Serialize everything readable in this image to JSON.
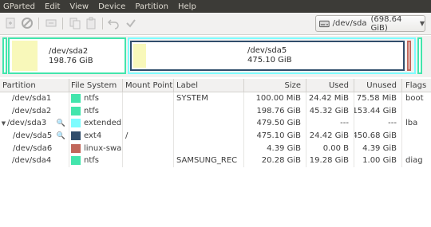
{
  "menu": [
    "GParted",
    "Edit",
    "View",
    "Device",
    "Partition",
    "Help"
  ],
  "toolbar": {
    "icons": [
      "new-icon",
      "delete-icon",
      "resize-icon",
      "copy-icon",
      "paste-icon",
      "undo-icon",
      "apply-icon"
    ]
  },
  "device": {
    "name": "/dev/sda",
    "size": "(698.64 GiB)"
  },
  "diskmap": {
    "sda2": {
      "name": "/dev/sda2",
      "size": "198.76 GiB"
    },
    "sda5": {
      "name": "/dev/sda5",
      "size": "475.10 GiB"
    }
  },
  "columns": [
    "Partition",
    "File System",
    "Mount Point",
    "Label",
    "Size",
    "Used",
    "Unused",
    "Flags"
  ],
  "rows": [
    {
      "partition": "/dev/sda1",
      "fs": "ntfs",
      "fs_color": "#42e5ac",
      "mount": "",
      "label": "SYSTEM",
      "size": "100.00 MiB",
      "used": "24.42 MiB",
      "unused": "75.58 MiB",
      "flags": "boot",
      "level": 0
    },
    {
      "partition": "/dev/sda2",
      "fs": "ntfs",
      "fs_color": "#42e5ac",
      "mount": "",
      "label": "",
      "size": "198.76 GiB",
      "used": "45.32 GiB",
      "unused": "153.44 GiB",
      "flags": "",
      "level": 0
    },
    {
      "partition": "/dev/sda3",
      "fs": "extended",
      "fs_color": "#7dfcfe",
      "mount": "",
      "label": "",
      "size": "479.50 GiB",
      "used": "---",
      "unused": "---",
      "flags": "lba",
      "level": 0
    },
    {
      "partition": "/dev/sda5",
      "fs": "ext4",
      "fs_color": "#314e6c",
      "mount": "/",
      "label": "",
      "size": "475.10 GiB",
      "used": "24.42 GiB",
      "unused": "450.68 GiB",
      "flags": "",
      "level": 1
    },
    {
      "partition": "/dev/sda6",
      "fs": "linux-swap",
      "fs_color": "#c1665a",
      "mount": "",
      "label": "",
      "size": "4.39 GiB",
      "used": "0.00 B",
      "unused": "4.39 GiB",
      "flags": "",
      "level": 1
    },
    {
      "partition": "/dev/sda4",
      "fs": "ntfs",
      "fs_color": "#42e5ac",
      "mount": "",
      "label": "SAMSUNG_REC",
      "size": "20.28 GiB",
      "used": "19.28 GiB",
      "unused": "1.00 GiB",
      "flags": "diag",
      "level": 0
    }
  ],
  "colors": {
    "ntfs": "#42e5ac",
    "extended": "#7dfcfe",
    "ext4": "#314e6c",
    "swap": "#c1665a",
    "used_fill": "#f8f8ba"
  }
}
